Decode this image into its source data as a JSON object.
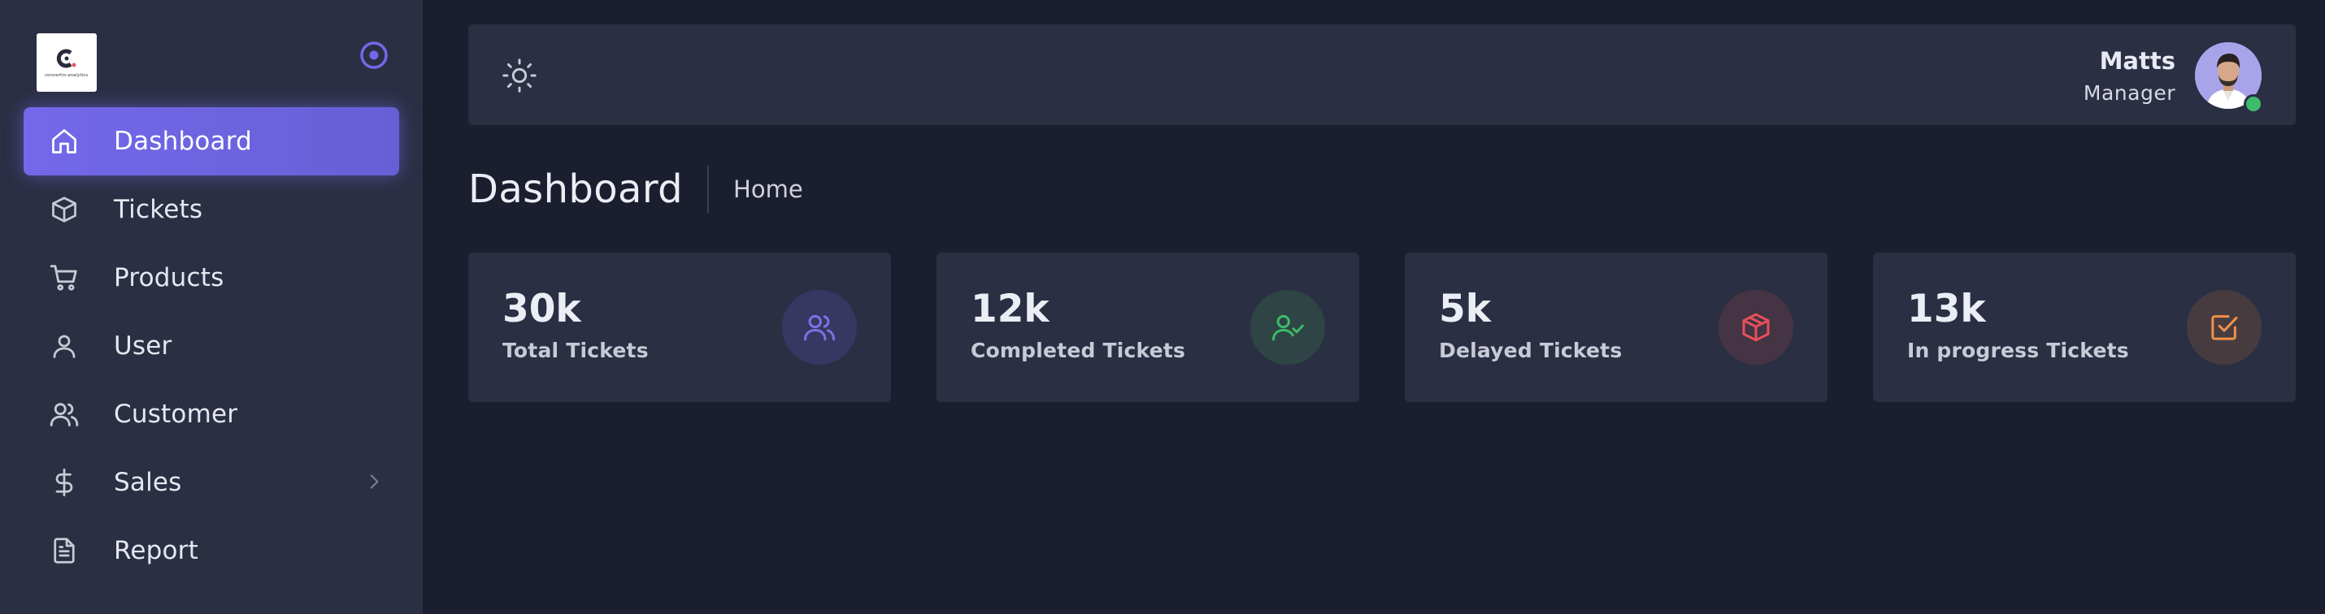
{
  "sidebar": {
    "logo_text": "convertio-analytics",
    "items": [
      {
        "label": "Dashboard",
        "icon": "home-icon",
        "active": true
      },
      {
        "label": "Tickets",
        "icon": "box-icon"
      },
      {
        "label": "Products",
        "icon": "cart-icon"
      },
      {
        "label": "User",
        "icon": "user-icon"
      },
      {
        "label": "Customer",
        "icon": "users-icon"
      },
      {
        "label": "Sales",
        "icon": "dollar-icon",
        "has_submenu": true
      },
      {
        "label": "Report",
        "icon": "document-icon"
      }
    ]
  },
  "header": {
    "theme_icon": "sun-icon",
    "user": {
      "name": "Matts",
      "role": "Manager",
      "status": "online"
    }
  },
  "page": {
    "title": "Dashboard",
    "breadcrumb": "Home"
  },
  "stats": [
    {
      "value": "30k",
      "label": "Total Tickets",
      "icon": "users-icon",
      "color": "#7c73e6"
    },
    {
      "value": "12k",
      "label": "Completed Tickets",
      "icon": "user-check-icon",
      "color": "#3dbb6b"
    },
    {
      "value": "5k",
      "label": "Delayed Tickets",
      "icon": "box-icon",
      "color": "#e8505b"
    },
    {
      "value": "13k",
      "label": "In progress Tickets",
      "icon": "check-square-icon",
      "color": "#f0904a"
    }
  ],
  "colors": {
    "accent": "#7468ea",
    "background": "#1b1e2e",
    "panel": "#2b2f44"
  }
}
